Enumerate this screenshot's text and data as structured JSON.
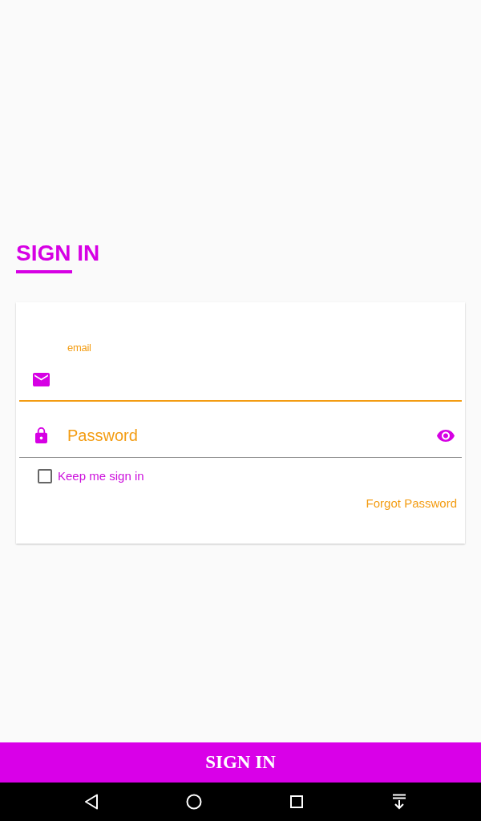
{
  "title": "SIGN IN",
  "form": {
    "email_field": {
      "label": "email",
      "focused": true
    },
    "password_field": {
      "placeholder": "Password"
    },
    "keep_signed_in": {
      "label": "Keep me sign in",
      "checked": false
    },
    "forgot_password": "Forgot Password"
  },
  "submit_button": "SIGN IN"
}
